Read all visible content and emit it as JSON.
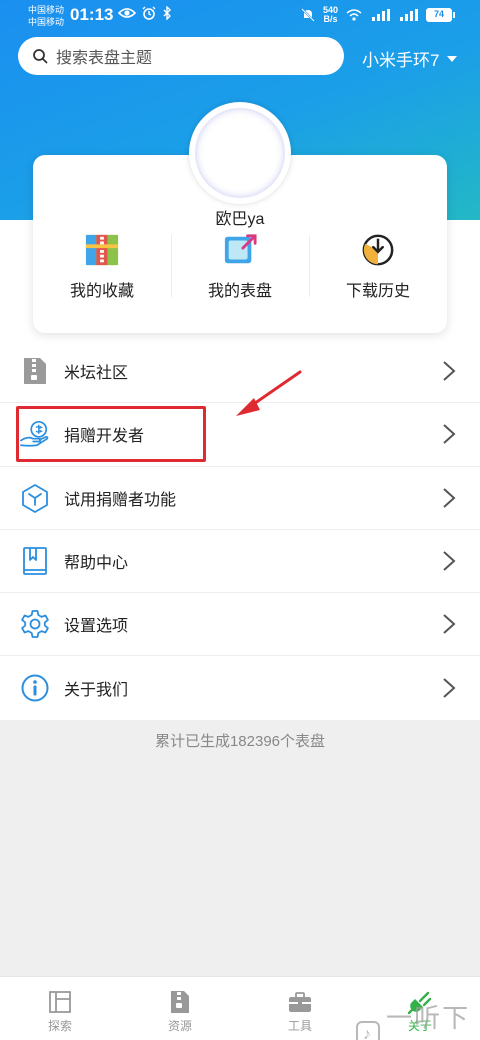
{
  "status_bar": {
    "carrier1": "中国移动",
    "carrier2": "中国移动",
    "time": "01:13",
    "net_speed_value": "540",
    "net_speed_unit": "B/s",
    "battery": "74"
  },
  "search": {
    "placeholder": "搜索表盘主题"
  },
  "device_selector": {
    "label": "小米手环7"
  },
  "profile": {
    "username": "欧巴ya"
  },
  "quick_actions": [
    {
      "label": "我的收藏",
      "icon": "archive-icon"
    },
    {
      "label": "我的表盘",
      "icon": "edit-square-icon"
    },
    {
      "label": "下载历史",
      "icon": "download-clock-icon"
    }
  ],
  "menu": [
    {
      "label": "米坛社区",
      "icon": "zip-file-icon"
    },
    {
      "label": "捐赠开发者",
      "icon": "donate-coin-hand-icon"
    },
    {
      "label": "试用捐赠者功能",
      "icon": "cube-icon"
    },
    {
      "label": "帮助中心",
      "icon": "book-icon"
    },
    {
      "label": "设置选项",
      "icon": "gear-icon"
    },
    {
      "label": "关于我们",
      "icon": "info-icon"
    }
  ],
  "footer": {
    "count_text": "累计已生成182396个表盘"
  },
  "bottom_nav": [
    {
      "label": "探索",
      "icon": "explore-icon",
      "active": false
    },
    {
      "label": "资源",
      "icon": "resource-icon",
      "active": false
    },
    {
      "label": "工具",
      "icon": "toolbox-icon",
      "active": false
    },
    {
      "label": "关于",
      "icon": "about-plug-icon",
      "active": true
    }
  ],
  "watermark": {
    "text": "一听下载"
  },
  "colors": {
    "header_gradient_start": "#1a8ff0",
    "header_gradient_end": "#23b8c6",
    "highlight_red": "#e02a31",
    "nav_active": "#34b24a",
    "icon_blue": "#2b8fe0"
  }
}
